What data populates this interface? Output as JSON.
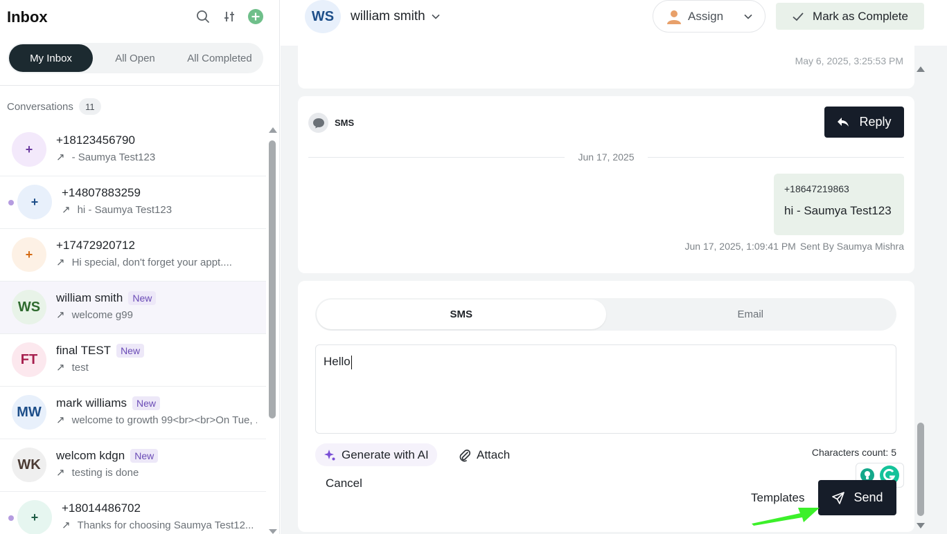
{
  "sidebar": {
    "title": "Inbox",
    "filters": [
      "My Inbox",
      "All Open",
      "All Completed"
    ],
    "conversations_label": "Conversations",
    "conversations_count": "11",
    "items": [
      {
        "initials": "+",
        "name": "+18123456790",
        "badge": "",
        "preview": "- Saumya Test123",
        "avatar_bg": "#f3e9fb",
        "avatar_fg": "#6a3aa0",
        "unread": false
      },
      {
        "initials": "+",
        "name": "+14807883259",
        "badge": "",
        "preview": "hi - Saumya Test123",
        "avatar_bg": "#e8f0fb",
        "avatar_fg": "#1d4e89",
        "unread": true
      },
      {
        "initials": "+",
        "name": "+17472920712",
        "badge": "",
        "preview": "Hi special, don't forget your appt....",
        "avatar_bg": "#fdf1e5",
        "avatar_fg": "#d46a12",
        "unread": false
      },
      {
        "initials": "WS",
        "name": "william smith",
        "badge": "New",
        "preview": "welcome g99",
        "avatar_bg": "#e8f3e8",
        "avatar_fg": "#2f6b2f",
        "unread": false
      },
      {
        "initials": "FT",
        "name": "final TEST",
        "badge": "New",
        "preview": "test",
        "avatar_bg": "#fce8ee",
        "avatar_fg": "#a61e4d",
        "unread": false
      },
      {
        "initials": "MW",
        "name": "mark williams",
        "badge": "New",
        "preview": "welcome to growth 99<br><br>On Tue, ...",
        "avatar_bg": "#e8f0fb",
        "avatar_fg": "#1d4e89",
        "unread": false
      },
      {
        "initials": "WK",
        "name": "welcom kdgn",
        "badge": "New",
        "preview": "testing is done",
        "avatar_bg": "#efefef",
        "avatar_fg": "#4b3b34",
        "unread": false
      },
      {
        "initials": "+",
        "name": "+18014486702",
        "badge": "",
        "preview": "Thanks for choosing Saumya Test12...",
        "avatar_bg": "#e6f6f0",
        "avatar_fg": "#1f5c46",
        "unread": true
      }
    ]
  },
  "header": {
    "avatar": "WS",
    "name": "william smith",
    "assign_label": "Assign",
    "complete_label": "Mark as Complete"
  },
  "thread": {
    "top_timestamp": "May 6, 2025, 3:25:53 PM",
    "channel": "SMS",
    "reply_label": "Reply",
    "date_separator": "Jun 17, 2025",
    "message_from": "+18647219863",
    "message_text": "hi - Saumya Test123",
    "message_time": "Jun 17, 2025, 1:09:41 PM",
    "message_sender": "Sent By Saumya Mishra"
  },
  "composer": {
    "tabs": [
      "SMS",
      "Email"
    ],
    "value": "Hello",
    "ai_label": "Generate with AI",
    "attach_label": "Attach",
    "char_count": "Characters count: 5",
    "cancel_label": "Cancel",
    "templates_label": "Templates",
    "send_label": "Send"
  },
  "colors": {
    "dark_button": "#161d29",
    "annotation_arrow": "#3cf02a"
  }
}
